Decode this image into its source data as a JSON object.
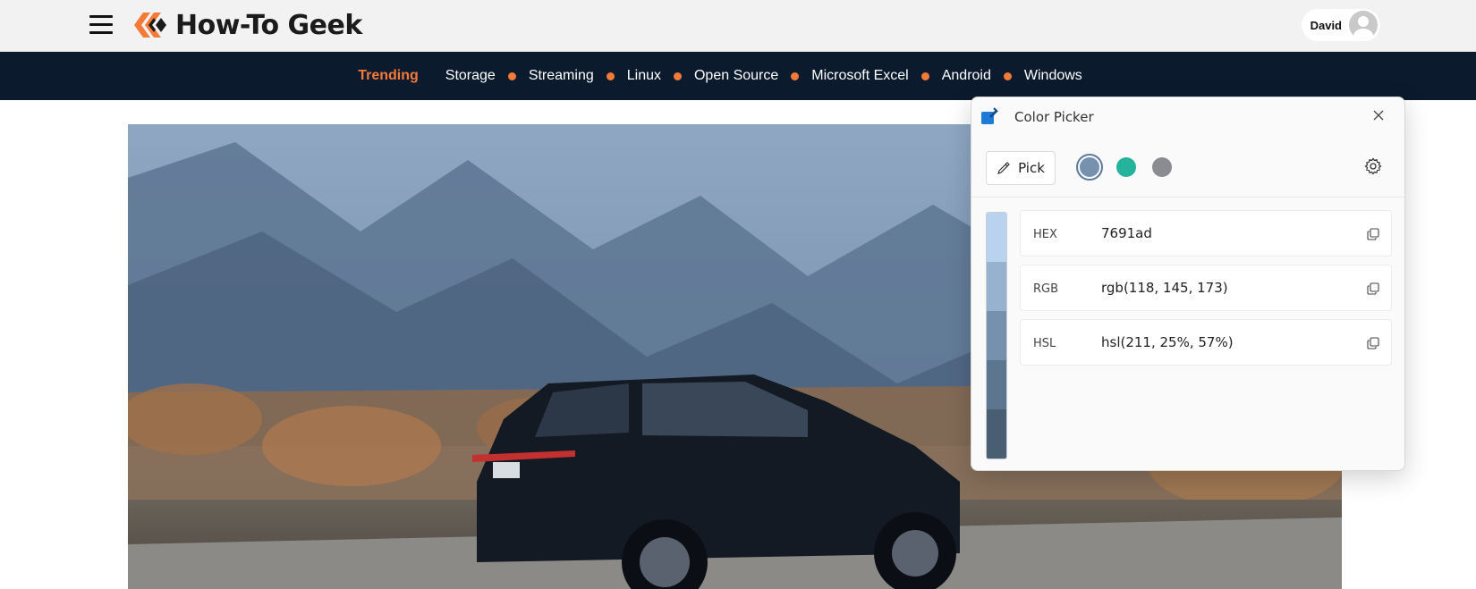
{
  "site": {
    "logo_text": "How-To Geek",
    "user_name": "David"
  },
  "nav": {
    "trending": "Trending",
    "items": [
      "Storage",
      "Streaming",
      "Linux",
      "Open Source",
      "Microsoft Excel",
      "Android",
      "Windows"
    ]
  },
  "colors": {
    "topbar": "#f2f2f2",
    "navbar": "#0c1a2e",
    "accent": "#f47a38"
  },
  "color_picker": {
    "title": "Color Picker",
    "pick_label": "Pick",
    "swatches": [
      {
        "color": "#7691ad",
        "selected": true
      },
      {
        "color": "#26b39c",
        "selected": false
      },
      {
        "color": "#8b8c91",
        "selected": false
      }
    ],
    "shades": [
      "#b9d3ef",
      "#97b2ce",
      "#7691ad",
      "#5d7690",
      "#4a5e73"
    ],
    "values": [
      {
        "label": "HEX",
        "value": "7691ad"
      },
      {
        "label": "RGB",
        "value": "rgb(118, 145, 173)"
      },
      {
        "label": "HSL",
        "value": "hsl(211, 25%, 57%)"
      }
    ]
  }
}
